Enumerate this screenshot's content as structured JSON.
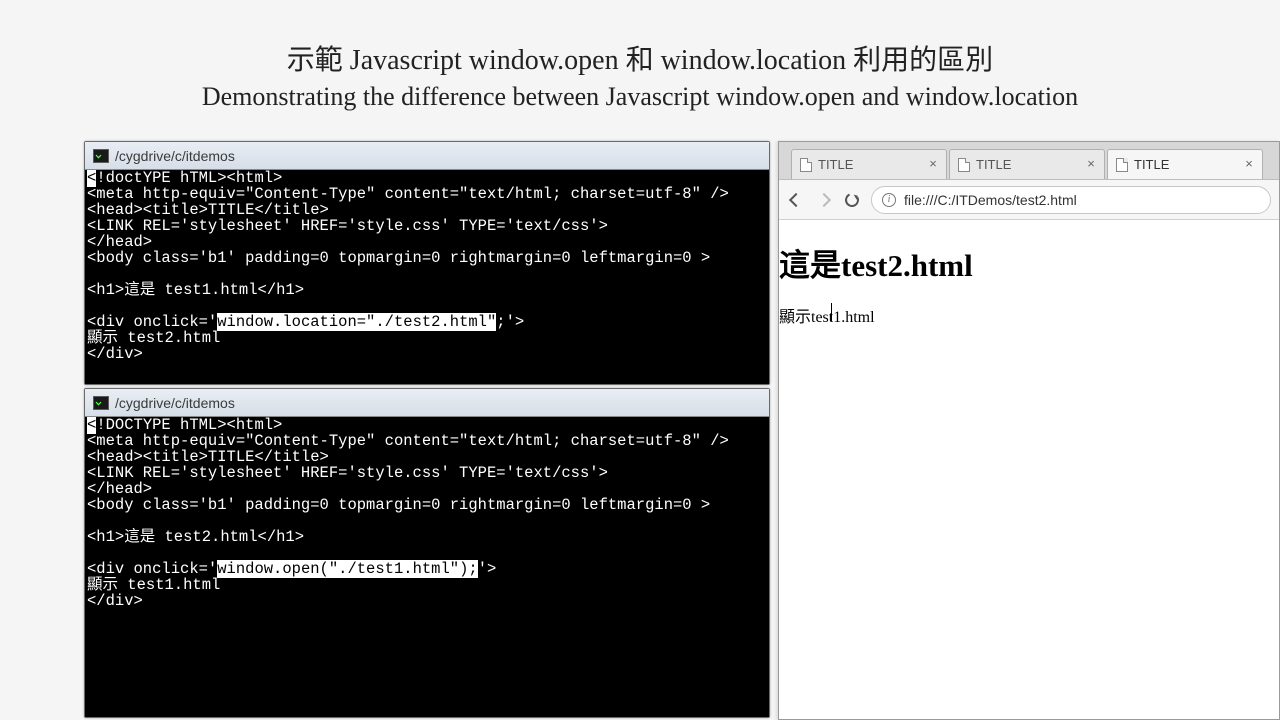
{
  "heading": {
    "zh": "示範 Javascript window.open 和 window.location 利用的區別",
    "en": "Demonstrating the difference between Javascript window.open and window.location"
  },
  "term1": {
    "path": "/cygdrive/c/itdemos",
    "lines": {
      "l0a": "<",
      "l0b": "!doctYPE hTML><html>",
      "l1": "<meta http-equiv=\"Content-Type\" content=\"text/html; charset=utf-8\" />",
      "l2": "<head><title>TITLE</title>",
      "l3": "<LINK REL='stylesheet' HREF='style.css' TYPE='text/css'>",
      "l4": "</head>",
      "l5": "<body class='b1' padding=0 topmargin=0 rightmargin=0 leftmargin=0 >",
      "blank": "",
      "l6": "<h1>這是 test1.html</h1>",
      "l7a": "<div onclick='",
      "l7b": "window.location=\"./test2.html\"",
      "l7c": ";'>",
      "l8": "顯示 test2.html",
      "l9": "</div>"
    }
  },
  "term2": {
    "path": "/cygdrive/c/itdemos",
    "lines": {
      "l0a": "<",
      "l0b": "!DOCTYPE hTML><html>",
      "l1": "<meta http-equiv=\"Content-Type\" content=\"text/html; charset=utf-8\" />",
      "l2": "<head><title>TITLE</title>",
      "l3": "<LINK REL='stylesheet' HREF='style.css' TYPE='text/css'>",
      "l4": "</head>",
      "l5": "<body class='b1' padding=0 topmargin=0 rightmargin=0 leftmargin=0 >",
      "blank": "",
      "l6": "<h1>這是 test2.html</h1>",
      "l7a": "<div onclick='",
      "l7b": "window.open(\"./test1.html\");",
      "l7c": "'>",
      "l8": "顯示 test1.html",
      "l9": "</div>"
    }
  },
  "browser": {
    "tabs": [
      {
        "label": "TITLE",
        "active": false
      },
      {
        "label": "TITLE",
        "active": false
      },
      {
        "label": "TITLE",
        "active": true
      }
    ],
    "url": "file:///C:/ITDemos/test2.html",
    "page": {
      "h1": "這是test2.html",
      "link": "顯示test1.html"
    }
  }
}
